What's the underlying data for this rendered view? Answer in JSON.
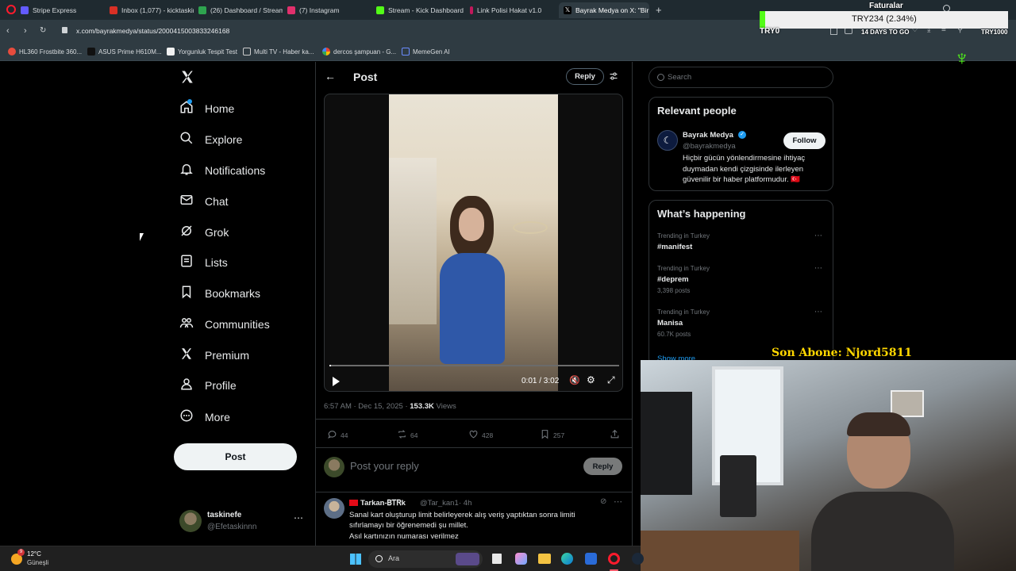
{
  "browser": {
    "tabs": [
      {
        "title": "Stripe Express",
        "color": "#635bff"
      },
      {
        "title": "Inbox (1,077) - kicktaskin",
        "color": "#d93025"
      },
      {
        "title": "(26) Dashboard / Streamla",
        "color": "#2ea44f"
      },
      {
        "title": "(7) Instagram",
        "color": "#e1306c"
      },
      {
        "title": "Stream - Kick Dashboard",
        "color": "#53fc18"
      },
      {
        "title": "Link Polisi Hakat v1.0",
        "color": "#c2185b"
      },
      {
        "title": "Bayrak Medya on X: \"Bir k",
        "color": "#000000"
      }
    ],
    "url": "x.com/bayrakmedya/status/2000415003833246168",
    "bookmarks": [
      "HL360 Frostbite 360...",
      "ASUS Prime H610M...",
      "Yorgunluk Tespit Test",
      "Multi TV - Haber ka...",
      "dercos şampuan - G...",
      "MemeGen AI"
    ]
  },
  "overlay": {
    "faturalar_label": "Faturalar",
    "ticker": "TRY234 (2.34%)",
    "try_label": "TRY0",
    "days_to_go": "14 DAYS TO GO",
    "try_right": "TRY1000",
    "son_abone": "Son Abone: Njord5811"
  },
  "sidebar": {
    "items": [
      {
        "label": "Home",
        "icon": "home-icon"
      },
      {
        "label": "Explore",
        "icon": "search-icon"
      },
      {
        "label": "Notifications",
        "icon": "bell-icon"
      },
      {
        "label": "Chat",
        "icon": "mail-icon"
      },
      {
        "label": "Grok",
        "icon": "grok-icon"
      },
      {
        "label": "Lists",
        "icon": "lists-icon"
      },
      {
        "label": "Bookmarks",
        "icon": "bookmark-icon"
      },
      {
        "label": "Communities",
        "icon": "communities-icon"
      },
      {
        "label": "Premium",
        "icon": "x-logo-icon"
      },
      {
        "label": "Profile",
        "icon": "profile-icon"
      },
      {
        "label": "More",
        "icon": "more-icon"
      }
    ],
    "post_button": "Post",
    "account": {
      "name": "taskinefe",
      "handle": "@Efetaskinnn"
    }
  },
  "main": {
    "header_title": "Post",
    "reply_button": "Reply",
    "video": {
      "time": "0:01 / 3:02",
      "progress": 0.005
    },
    "meta": {
      "time": "6:57 AM · Dec 15, 2025 · ",
      "views_count": "153.3K",
      "views_label": " Views"
    },
    "stats": {
      "replies": "44",
      "reposts": "64",
      "likes": "428",
      "bookmarks": "257"
    },
    "reply_placeholder": "Post your reply",
    "reply_submit": "Reply",
    "comment": {
      "name": "Tarkan-ᏴᎢᏒk",
      "handle": "@Tar_kan1",
      "time": "· 4h",
      "lines": [
        "Sanal kart oluşturup limit belirleyerek alış veriş yaptıktan sonra limiti",
        "sıfırlamayı bir öğrenemedi şu millet.",
        "Asıl kartınızın numarası verilmez"
      ]
    }
  },
  "right": {
    "search_placeholder": "Search",
    "relevant_title": "Relevant people",
    "person": {
      "name": "Bayrak Medya",
      "handle": "@bayrakmedya",
      "follow": "Follow",
      "bio": [
        "Hiçbir gücün yönlendirmesine ihtiyaç",
        "duymadan kendi çizgisinde ilerleyen",
        "güvenilir bir haber platformudur. 🇹🇷"
      ]
    },
    "happening_title": "What’s happening",
    "trends": [
      {
        "context": "Trending in Turkey",
        "tag": "#manifest",
        "posts": ""
      },
      {
        "context": "Trending in Turkey",
        "tag": "#deprem",
        "posts": "3,398 posts"
      },
      {
        "context": "Trending in Turkey",
        "tag": "Manisa",
        "posts": "60.7K posts"
      }
    ],
    "show_more": "Show more"
  },
  "taskbar": {
    "temp": "12°C",
    "weather": "Güneşli",
    "search": "Ara",
    "badge": "9"
  },
  "colors": {
    "accent": "#1d9bf0",
    "muted": "#71767b",
    "border": "#2f3336",
    "overlay_green": "#53fc18",
    "overlay_text": "#ffd700"
  }
}
